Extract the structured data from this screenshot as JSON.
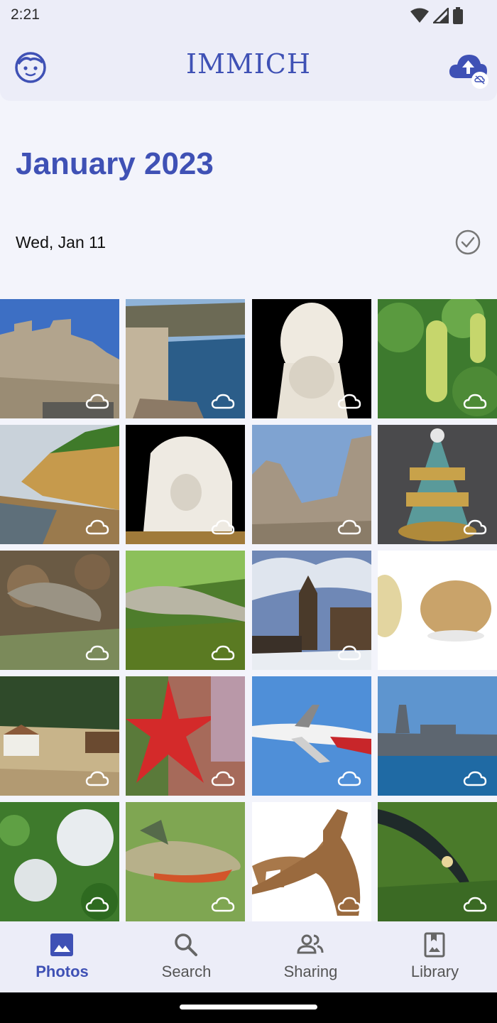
{
  "status_bar": {
    "time": "2:21"
  },
  "app_bar": {
    "title": "IMMICH"
  },
  "timeline": {
    "month_header": "January 2023",
    "day_label": "Wed, Jan 11"
  },
  "assets": [
    {
      "subject": "stone fortress walls"
    },
    {
      "subject": "harbor with city walls"
    },
    {
      "subject": "bust sculpture"
    },
    {
      "subject": "sea grape plant"
    },
    {
      "subject": "coastal cliff beach"
    },
    {
      "subject": "marble sculpture"
    },
    {
      "subject": "castle ruins"
    },
    {
      "subject": "ornate porcelain centerpiece"
    },
    {
      "subject": "lizard on leaves"
    },
    {
      "subject": "lizard on moss"
    },
    {
      "subject": "wooden church in snow"
    },
    {
      "subject": "potatoes"
    },
    {
      "subject": "alpine farmhouse"
    },
    {
      "subject": "red starfish"
    },
    {
      "subject": "airliner"
    },
    {
      "subject": "warship"
    },
    {
      "subject": "cottonwood fluff"
    },
    {
      "subject": "perch fish"
    },
    {
      "subject": "dinosaurs illustration"
    },
    {
      "subject": "snake in grass"
    }
  ],
  "bottom_nav": {
    "items": [
      {
        "label": "Photos",
        "icon": "photo-icon",
        "active": true
      },
      {
        "label": "Search",
        "icon": "search-icon",
        "active": false
      },
      {
        "label": "Sharing",
        "icon": "people-icon",
        "active": false
      },
      {
        "label": "Library",
        "icon": "library-icon",
        "active": false
      }
    ]
  },
  "colors": {
    "accent": "#3f51b5",
    "background": "#f3f4fb",
    "bar": "#ecedf8"
  }
}
